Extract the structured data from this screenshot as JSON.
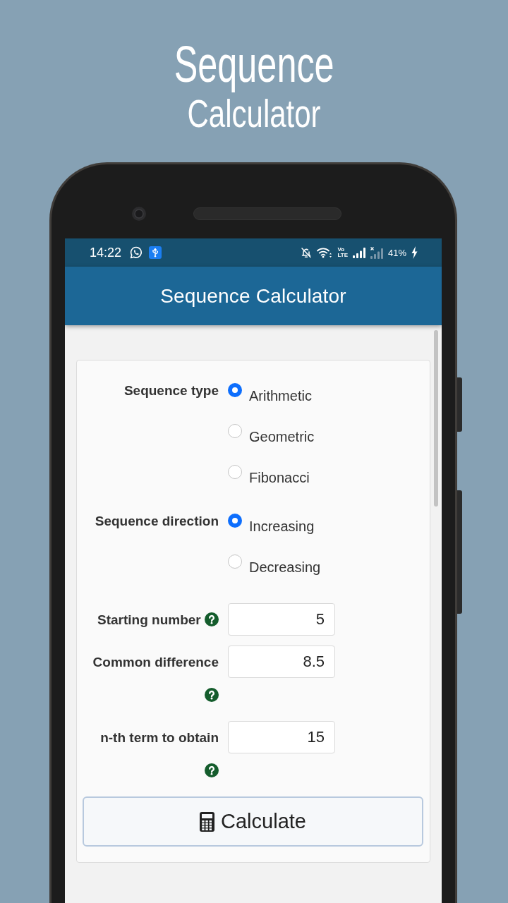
{
  "header": {
    "title": "Sequence",
    "subtitle": "Calculator"
  },
  "status_bar": {
    "time": "14:22",
    "network_badge": [
      "Vo",
      "LTE"
    ],
    "battery": "41%"
  },
  "app_bar": {
    "title": "Sequence Calculator"
  },
  "form": {
    "groups": [
      {
        "label": "Sequence type",
        "options": [
          {
            "label": "Arithmetic",
            "selected": true
          },
          {
            "label": "Geometric",
            "selected": false
          },
          {
            "label": "Fibonacci",
            "selected": false
          }
        ]
      },
      {
        "label": "Sequence direction",
        "options": [
          {
            "label": "Increasing",
            "selected": true
          },
          {
            "label": "Decreasing",
            "selected": false
          }
        ]
      }
    ],
    "fields": [
      {
        "label": "Starting number",
        "value": "5",
        "help": true
      },
      {
        "label": "Common difference",
        "value": "8.5",
        "help": true
      },
      {
        "label": "n-th term to obtain",
        "value": "15",
        "help": true
      }
    ],
    "button": "Calculate"
  }
}
